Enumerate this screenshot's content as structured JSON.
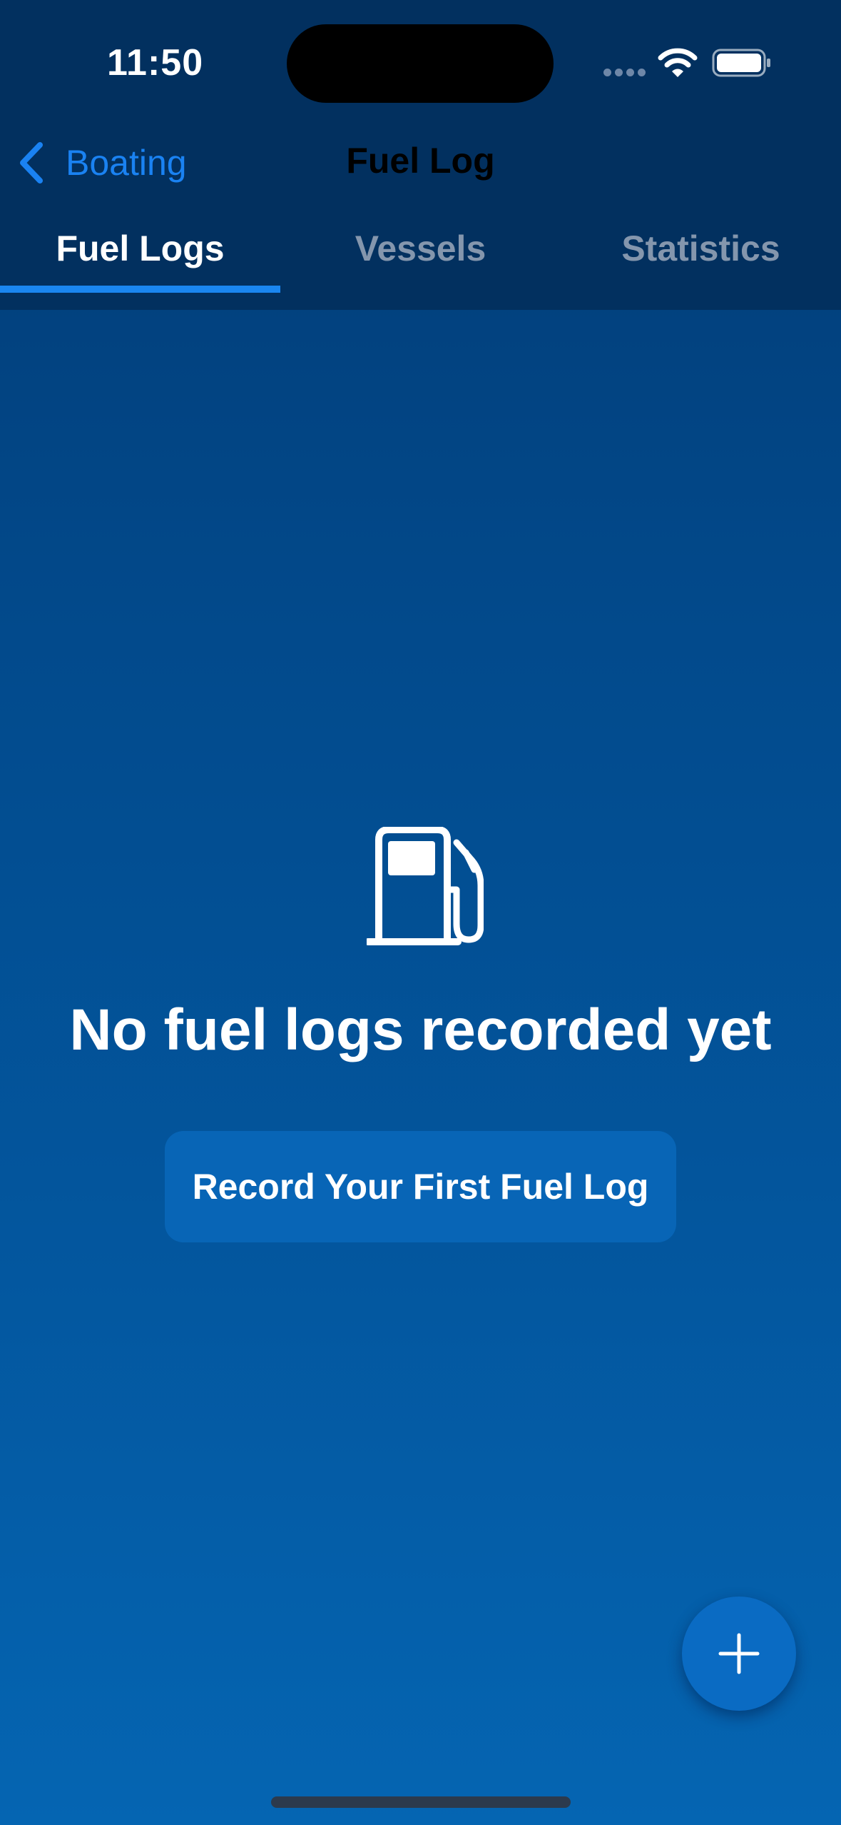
{
  "status_bar": {
    "time": "11:50"
  },
  "nav": {
    "back_label": "Boating",
    "title": "Fuel Log"
  },
  "tabs": [
    {
      "label": "Fuel Logs",
      "active": true
    },
    {
      "label": "Vessels",
      "active": false
    },
    {
      "label": "Statistics",
      "active": false
    }
  ],
  "empty_state": {
    "icon": "fuel-pump-icon",
    "message": "No fuel logs recorded yet",
    "button_label": "Record Your First Fuel Log"
  },
  "fab": {
    "icon": "plus-icon"
  },
  "colors": {
    "accent": "#1a86f0",
    "link": "#1a82f2",
    "header_bg": "#02305f",
    "button_bg": "#0865b6",
    "inactive_tab": "#8496ad"
  }
}
